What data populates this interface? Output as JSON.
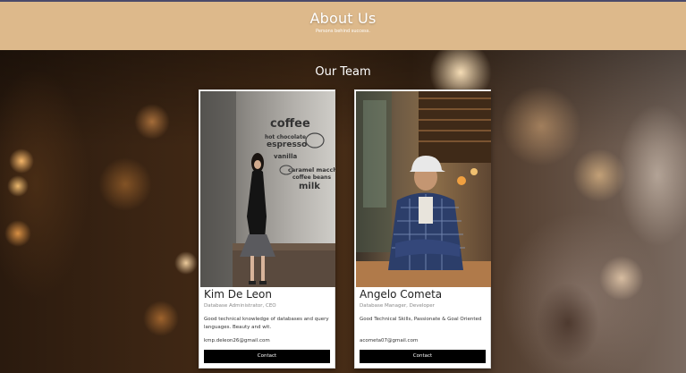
{
  "header": {
    "title": "About Us",
    "subtitle": "Persons behind success."
  },
  "team": {
    "title": "Our Team",
    "members": [
      {
        "name": "Kim De Leon",
        "role": "Database Administrator, CEO",
        "description": "Good technical knowledge of databases and query languages. Beauty and wit.",
        "email": "kmp.deleon26@gmail.com",
        "contact_label": "Contact",
        "photo_sign": [
          "coffee",
          "hot chocolate",
          "espresso",
          "vanilla",
          "caramel macchiato",
          "coffee beans",
          "milk"
        ]
      },
      {
        "name": "Angelo Cometa",
        "role": "Database Manager, Developer",
        "description": "Good Technical Skills, Passionate & Goal Oriented",
        "email": "acometa07@gmail.com",
        "contact_label": "Contact"
      }
    ]
  },
  "colors": {
    "header_bg": "#ddb98b",
    "button_bg": "#000000",
    "card_bg": "#ffffff"
  }
}
